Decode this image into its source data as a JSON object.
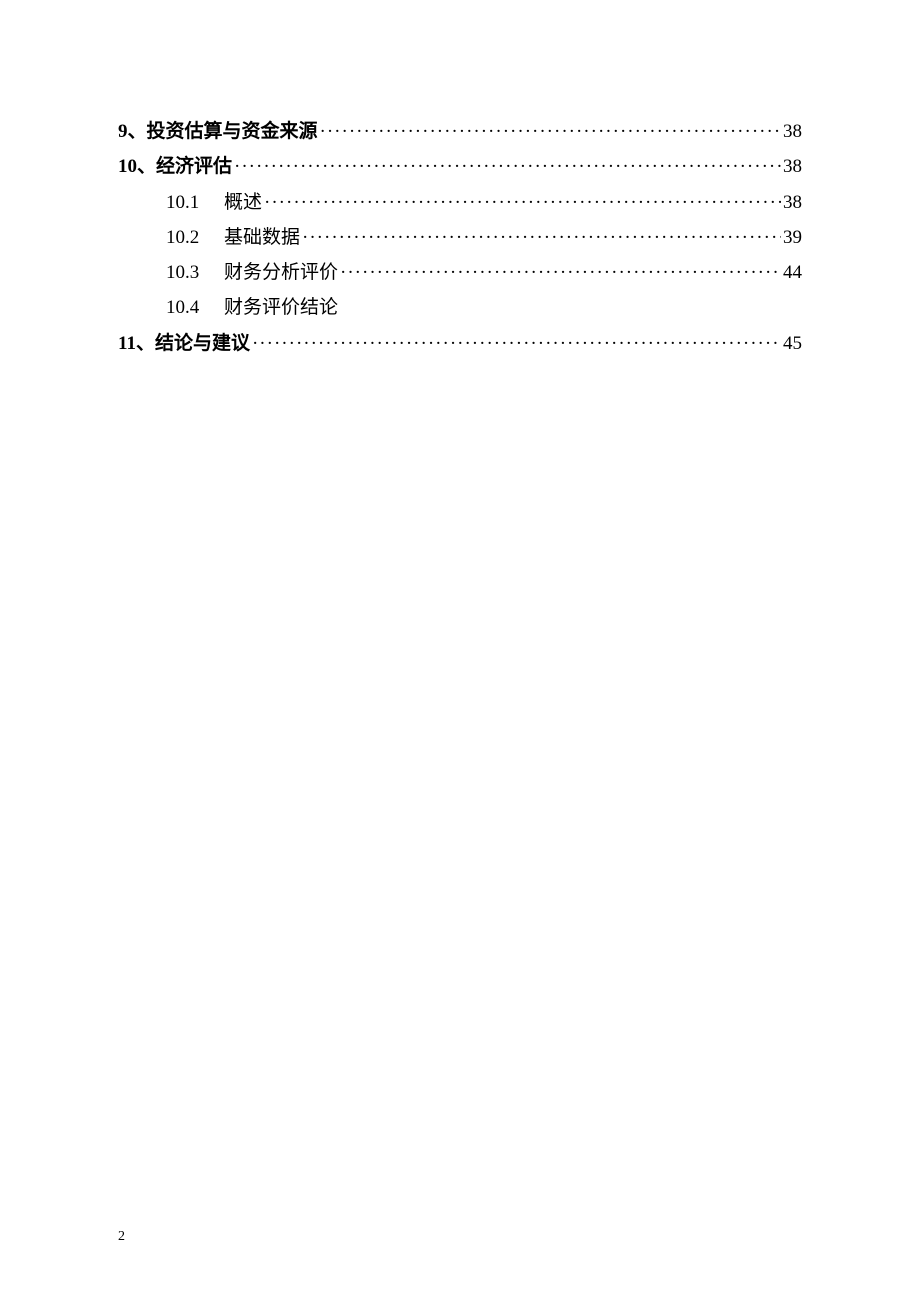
{
  "toc": {
    "entries": [
      {
        "level": 1,
        "num": "9",
        "sep": "、",
        "title": "投资估算与资金来源",
        "page": "38"
      },
      {
        "level": 1,
        "num": "10",
        "sep": "、",
        "title": "经济评估",
        "page": "38"
      },
      {
        "level": 2,
        "num": "10.1",
        "title": "概述",
        "page": "38"
      },
      {
        "level": 2,
        "num": "10.2",
        "title": "基础数据",
        "page": "39"
      },
      {
        "level": 2,
        "num": "10.3",
        "title": "财务分析评价",
        "page": "44"
      },
      {
        "level": 2,
        "num": "10.4",
        "title": "财务评价结论",
        "page": ""
      },
      {
        "level": 1,
        "num": "11",
        "sep": "、",
        "title": "结论与建议",
        "page": "45"
      }
    ]
  },
  "pageNumber": "2"
}
